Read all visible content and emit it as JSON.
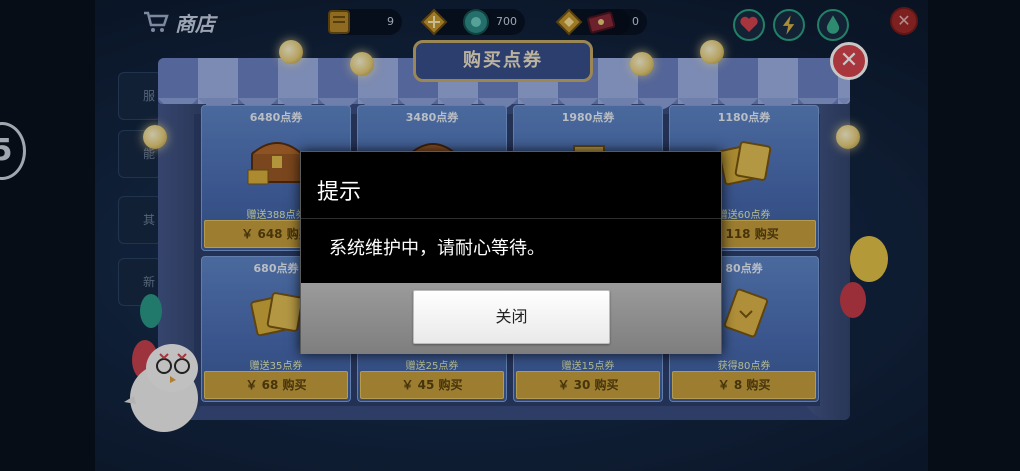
{
  "top_bar": {
    "title": "商店",
    "resources": [
      {
        "icon": "card-pack-icon",
        "value": "9"
      },
      {
        "icon": "diamond-icon",
        "value": ""
      },
      {
        "icon": "coin-icon",
        "value": "700"
      },
      {
        "icon": "gem-icon",
        "value": ""
      },
      {
        "icon": "ticket-icon",
        "value": "0"
      }
    ]
  },
  "store": {
    "banner": "购买点券",
    "cards": [
      {
        "title": "6480点券",
        "bonus": "赠送388点券",
        "price": "￥ 648 购买"
      },
      {
        "title": "3480点券",
        "bonus": "",
        "price": ""
      },
      {
        "title": "1980点券",
        "bonus": "",
        "price": ""
      },
      {
        "title": "1180点券",
        "bonus": "赠送60点券",
        "price": "￥ 118 购买"
      },
      {
        "title": "680点券",
        "bonus": "赠送35点券",
        "price": "￥ 68 购买"
      },
      {
        "title": "",
        "bonus": "赠送25点券",
        "price": "￥ 45 购买"
      },
      {
        "title": "",
        "bonus": "赠送15点券",
        "price": "￥ 30 购买"
      },
      {
        "title": "80点券",
        "bonus": "获得80点券",
        "price": "￥ 8 购买"
      }
    ]
  },
  "dialog": {
    "title": "提示",
    "message": "系统维护中，请耐心等待。",
    "close_label": "关闭"
  },
  "colors": {
    "dialog_bg": "#000000",
    "dialog_footer": "#8a8a8a",
    "price_button": "#c9a23f",
    "store_close": "#d9464f"
  }
}
